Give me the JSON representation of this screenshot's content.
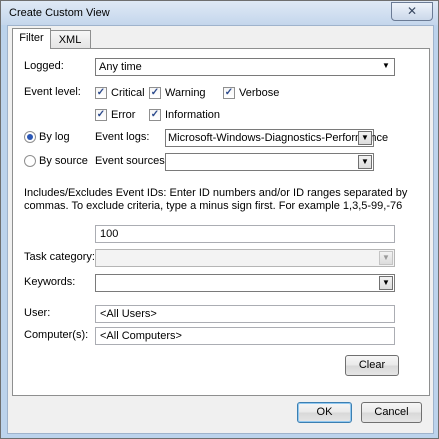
{
  "window": {
    "title": "Create Custom View",
    "close_glyph": "✕"
  },
  "tabs": [
    {
      "label": "Filter"
    },
    {
      "label": "XML"
    }
  ],
  "filter": {
    "logged": {
      "label": "Logged:",
      "value": "Any time"
    },
    "event_level": {
      "label": "Event level:",
      "options": [
        {
          "label": "Critical",
          "checked": true
        },
        {
          "label": "Warning",
          "checked": true
        },
        {
          "label": "Verbose",
          "checked": true
        },
        {
          "label": "Error",
          "checked": true
        },
        {
          "label": "Information",
          "checked": true
        }
      ]
    },
    "by_log": {
      "label": "By log",
      "selected": true
    },
    "by_source": {
      "label": "By source",
      "selected": false
    },
    "event_logs": {
      "label": "Event logs:",
      "value": "Microsoft-Windows-Diagnostics-Performance"
    },
    "event_sources": {
      "label": "Event sources:",
      "value": ""
    },
    "event_ids_info": "Includes/Excludes Event IDs: Enter ID numbers and/or ID ranges separated by commas. To exclude criteria, type a minus sign first. For example 1,3,5-99,-76",
    "event_ids": {
      "value": "100"
    },
    "task_category": {
      "label": "Task category:",
      "value": ""
    },
    "keywords": {
      "label": "Keywords:",
      "value": ""
    },
    "user": {
      "label": "User:",
      "value": "<All Users>"
    },
    "computer": {
      "label": "Computer(s):",
      "value": "<All Computers>"
    },
    "clear_label": "Clear"
  },
  "footer": {
    "ok_label": "OK",
    "cancel_label": "Cancel"
  },
  "icons": {
    "check": "✓",
    "dropdown": "▼"
  }
}
